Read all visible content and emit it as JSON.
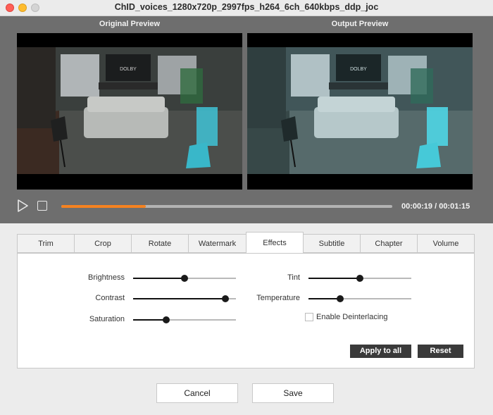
{
  "window": {
    "title": "ChID_voices_1280x720p_2997fps_h264_6ch_640kbps_ddp_joc"
  },
  "preview": {
    "original_label": "Original Preview",
    "output_label": "Output  Preview",
    "scene_logo": "DOLBY"
  },
  "playback": {
    "time": "00:00:19 / 00:01:15",
    "progress_fraction": 0.255
  },
  "tabs": [
    "Trim",
    "Crop",
    "Rotate",
    "Watermark",
    "Effects",
    "Subtitle",
    "Chapter",
    "Volume"
  ],
  "active_tab": "Effects",
  "effects": {
    "brightness": {
      "label": "Brightness",
      "level": 0.5
    },
    "contrast": {
      "label": "Contrast",
      "level": 0.9
    },
    "saturation": {
      "label": "Saturation",
      "level": 0.32
    },
    "tint": {
      "label": "Tint",
      "level": 0.5
    },
    "temperature": {
      "label": "Temperature",
      "level": 0.31
    },
    "deinterlace": {
      "label": "Enable Deinterlacing",
      "checked": false
    },
    "apply_all_label": "Apply to all",
    "reset_label": "Reset"
  },
  "footer": {
    "cancel_label": "Cancel",
    "save_label": "Save"
  },
  "colors": {
    "accent": "#f58220",
    "preview_bg": "#6e6e6e",
    "dark_button": "#3a3a3a"
  }
}
